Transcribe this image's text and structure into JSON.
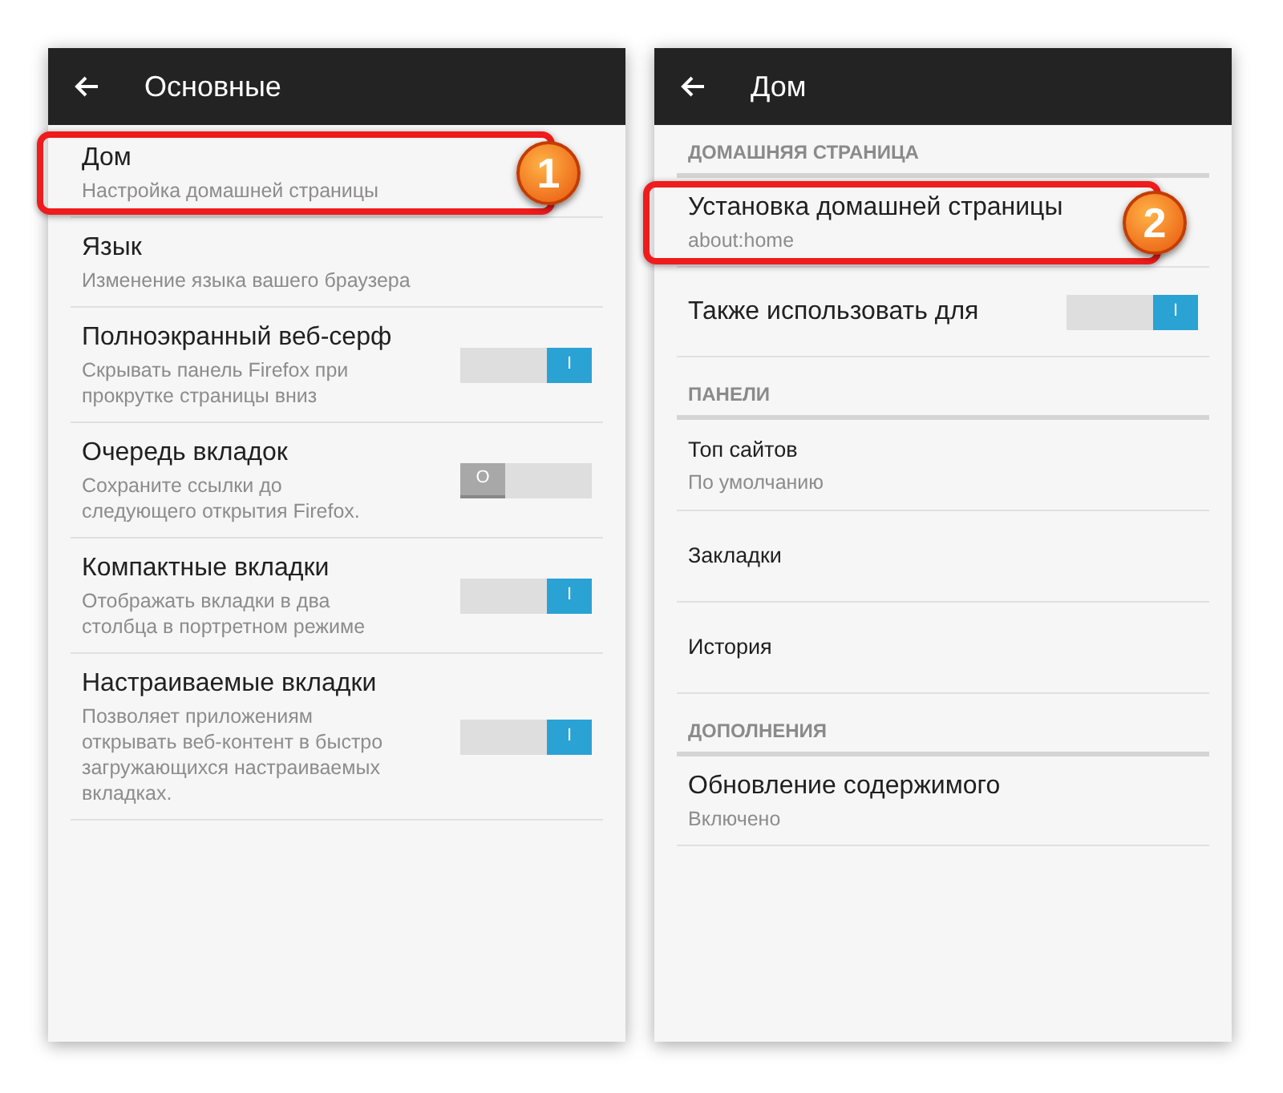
{
  "screens": [
    {
      "title": "Основные",
      "items": [
        {
          "kind": "item",
          "title": "Дом",
          "subtitle": "Настройка домашней страницы",
          "callout": "1"
        },
        {
          "kind": "item",
          "title": "Язык",
          "subtitle": "Изменение языка вашего браузера"
        },
        {
          "kind": "toggle",
          "title": "Полноэкранный веб-серф",
          "subtitle": "Скрывать панель Firefox при прокрутке страницы вниз",
          "on": true,
          "knob": "I"
        },
        {
          "kind": "toggle",
          "title": "Очередь вкладок",
          "subtitle": "Сохраните ссылки до следующего открытия Firefox.",
          "on": false,
          "knob": "O"
        },
        {
          "kind": "toggle",
          "title": "Компактные вкладки",
          "subtitle": "Отображать вкладки в два столбца в портретном режиме",
          "on": true,
          "knob": "I"
        },
        {
          "kind": "toggle",
          "title": "Настраиваемые вкладки",
          "subtitle": "Позволяет приложениям открывать веб-контент в быстро загружающихся настраиваемых вкладках.",
          "on": true,
          "knob": "I"
        }
      ]
    },
    {
      "title": "Дом",
      "items": [
        {
          "kind": "header",
          "title": "ДОМАШНЯЯ СТРАНИЦА"
        },
        {
          "kind": "item",
          "title": "Установка домашней страницы",
          "subtitle": "about:home",
          "callout": "2"
        },
        {
          "kind": "toggle",
          "title": "Также использовать для",
          "on": true,
          "knob": "I"
        },
        {
          "kind": "header",
          "title": "ПАНЕЛИ"
        },
        {
          "kind": "panel",
          "title": "Топ сайтов",
          "subtitle": "По умолчанию"
        },
        {
          "kind": "panel",
          "title": "Закладки"
        },
        {
          "kind": "panel",
          "title": "История"
        },
        {
          "kind": "header",
          "title": "ДОПОЛНЕНИЯ"
        },
        {
          "kind": "item",
          "title": "Обновление содержимого",
          "subtitle": "Включено"
        }
      ]
    }
  ]
}
